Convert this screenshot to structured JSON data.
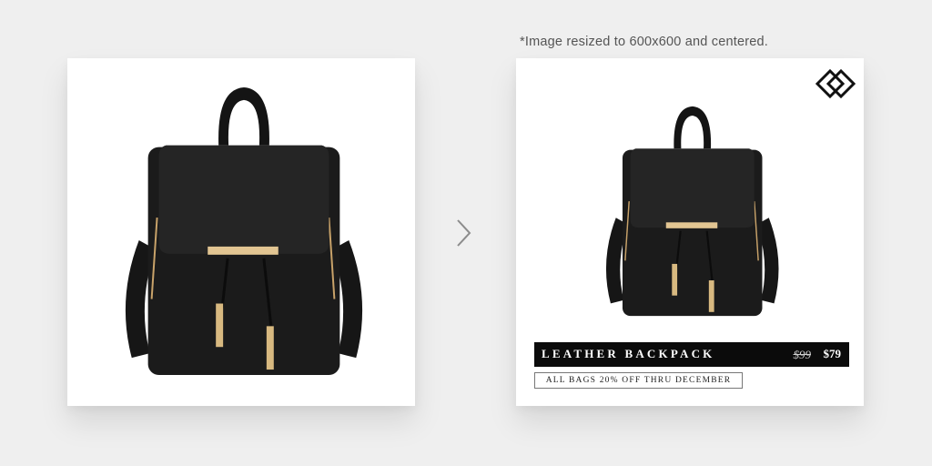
{
  "note": "*Image resized to 600x600 and centered.",
  "product": {
    "name": "LEATHER BACKPACK",
    "old_price": "$99",
    "new_price": "$79",
    "promo": "ALL BAGS 20% OFF THRU DECEMBER"
  },
  "colors": {
    "background": "#efefef",
    "card": "#ffffff",
    "banner": "#0b0b0b",
    "bag": "#1a1a1a",
    "hardware": "#d4b483"
  },
  "icons": {
    "arrow": "chevron-right-icon",
    "logo": "brand-logo"
  }
}
